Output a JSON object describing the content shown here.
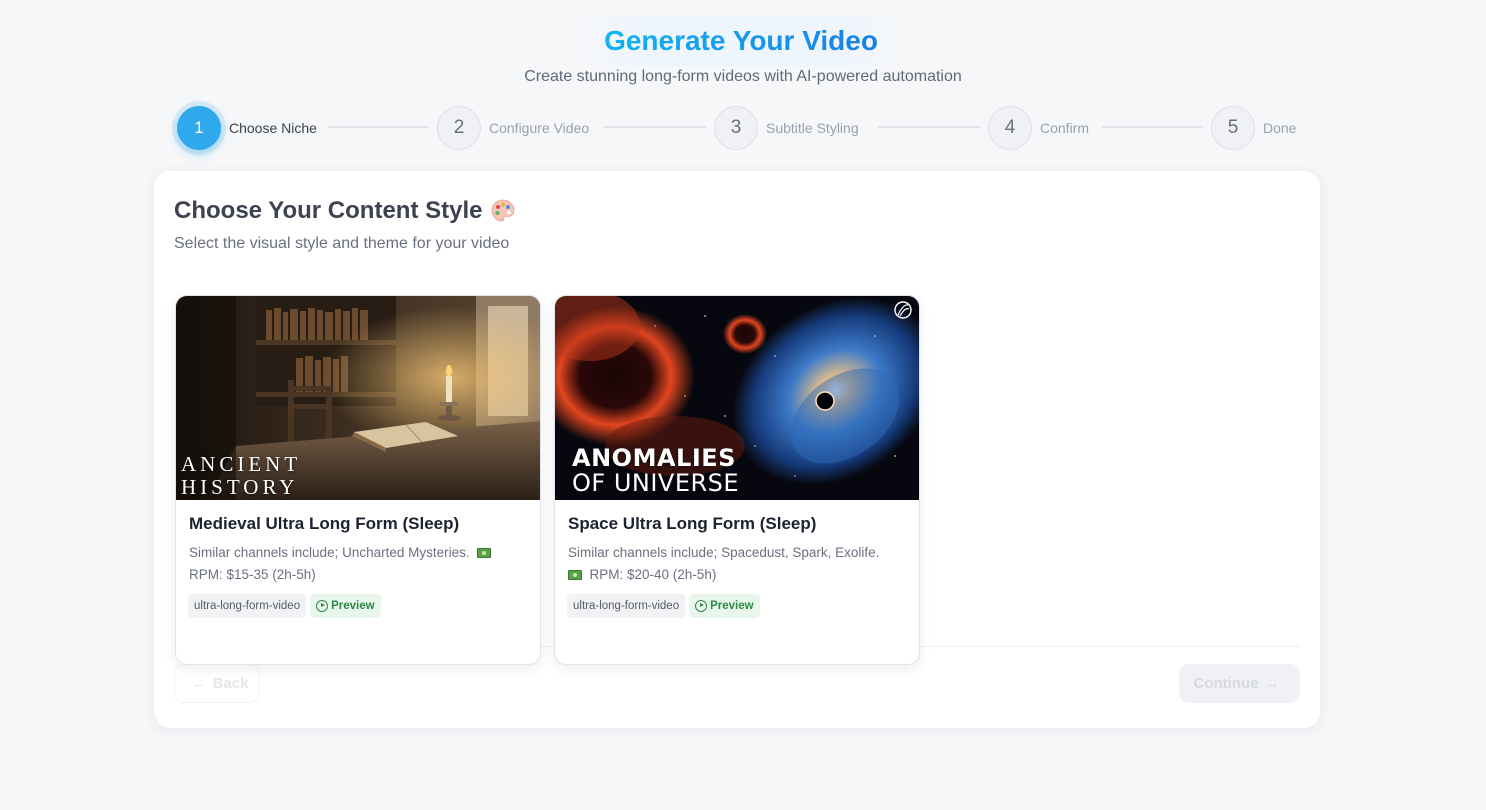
{
  "header": {
    "title": "Generate Your Video",
    "subtitle": "Create stunning long-form videos with AI-powered automation"
  },
  "stepper": {
    "steps": [
      {
        "number": "1",
        "label": "Choose Niche",
        "state": "active"
      },
      {
        "number": "2",
        "label": "Configure Video",
        "state": "inactive"
      },
      {
        "number": "3",
        "label": "Subtitle Styling",
        "state": "inactive"
      },
      {
        "number": "4",
        "label": "Confirm",
        "state": "inactive"
      },
      {
        "number": "5",
        "label": "Done",
        "state": "inactive"
      }
    ]
  },
  "panel": {
    "title": "Choose Your Content Style",
    "title_icon": "palette-icon",
    "subtitle": "Select the visual style and theme for your video"
  },
  "niches": [
    {
      "thumb_line1": "ANCIENT",
      "thumb_line2": "HISTORY",
      "title": "Medieval Ultra Long Form (Sleep)",
      "desc_main": "Similar channels include; Uncharted Mysteries.",
      "desc_rpm": "RPM: $15-35 (2h-5h)",
      "tag": "ultra-long-form-video",
      "preview": "Preview"
    },
    {
      "thumb_line1": "ANOMALIES",
      "thumb_line2": "OF UNIVERSE",
      "title": "Space Ultra Long Form (Sleep)",
      "desc_main": "Similar channels include; Spacedust, Spark, Exolife.",
      "desc_rpm": "RPM: $20-40 (2h-5h)",
      "tag": "ultra-long-form-video",
      "preview": "Preview"
    }
  ],
  "actions": {
    "back": "Back",
    "continue": "Continue"
  },
  "colors": {
    "accent": "#2fa8ec",
    "preview_green": "#2d8a45",
    "page_bg": "#f6f7f9"
  }
}
